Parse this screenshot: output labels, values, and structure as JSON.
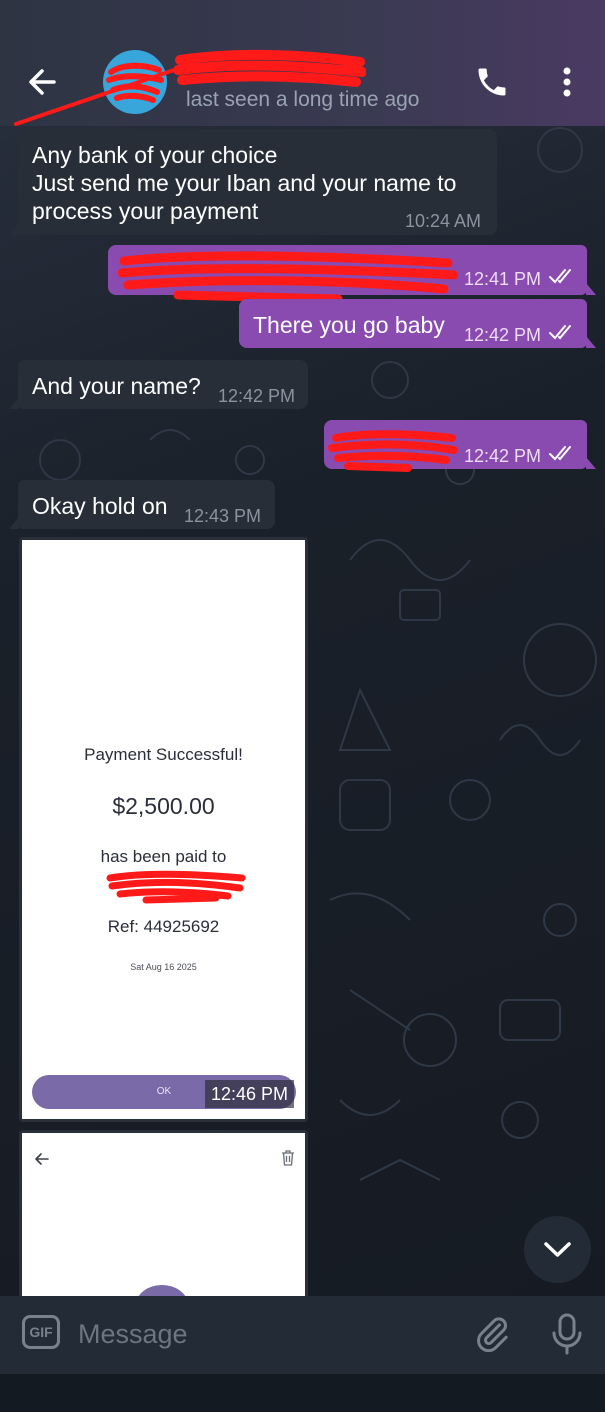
{
  "header": {
    "contact_name": "",
    "status": "last seen a long time ago"
  },
  "messages": [
    {
      "id": "m1",
      "direction": "incoming",
      "lines": [
        "Any bank of your choice",
        "Just send me your Iban and your name to",
        "process your payment"
      ],
      "time": "10:24 AM"
    },
    {
      "id": "m2",
      "direction": "outgoing",
      "text": "",
      "redacted": true,
      "time": "12:41 PM",
      "status": "read"
    },
    {
      "id": "m3",
      "direction": "outgoing",
      "text": "There you go baby",
      "time": "12:42 PM",
      "status": "read"
    },
    {
      "id": "m4",
      "direction": "incoming",
      "text": "And your name?",
      "time": "12:42 PM"
    },
    {
      "id": "m5",
      "direction": "outgoing",
      "text": "",
      "redacted": true,
      "time": "12:42 PM",
      "status": "read"
    },
    {
      "id": "m6",
      "direction": "incoming",
      "text": "Okay hold on",
      "time": "12:43 PM"
    }
  ],
  "photo": {
    "title": "Payment Successful!",
    "amount": "$2,500.00",
    "paid_to": "has been paid to",
    "ref": "Ref: 44925692",
    "date": "Sat Aug 16 2025",
    "ok_label": "OK",
    "time": "12:46 PM"
  },
  "composer": {
    "gif_label": "GIF",
    "placeholder": "Message"
  },
  "colors": {
    "outgoing_bubble": "#8a4bb0",
    "incoming_bubble": "#282e38",
    "redaction": "#ff0000",
    "avatar": "#38a5db"
  },
  "icons": [
    "back-arrow-icon",
    "phone-icon",
    "more-vert-icon",
    "double-check-icon",
    "chevron-down-icon",
    "paperclip-icon",
    "microphone-icon",
    "trash-icon"
  ]
}
